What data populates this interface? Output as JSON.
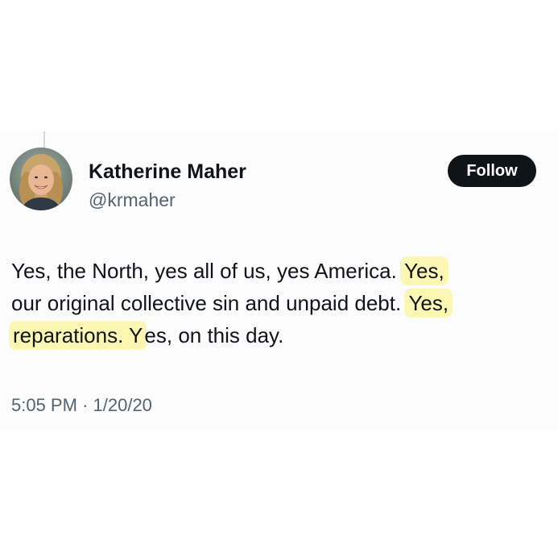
{
  "author": {
    "name": "Katherine Maher",
    "handle": "@krmaher",
    "avatar_icon": "profile-photo"
  },
  "follow_button": {
    "label": "Follow"
  },
  "tweet": {
    "line1_plain": "Yes, the North, yes all of us, yes America. ",
    "line1_highlight": "Yes,",
    "line2_plain": "our original collective sin and unpaid debt. ",
    "line2_highlight": "Yes,",
    "line3_highlight": "reparations. Y",
    "line3_plain": "es, on this day."
  },
  "meta": {
    "time": "5:05 PM",
    "separator": "·",
    "date": "1/20/20"
  },
  "colors": {
    "text": "#0f1419",
    "secondary_text": "#536471",
    "button_bg": "#0f1419",
    "highlight": "#fbf7b3"
  }
}
